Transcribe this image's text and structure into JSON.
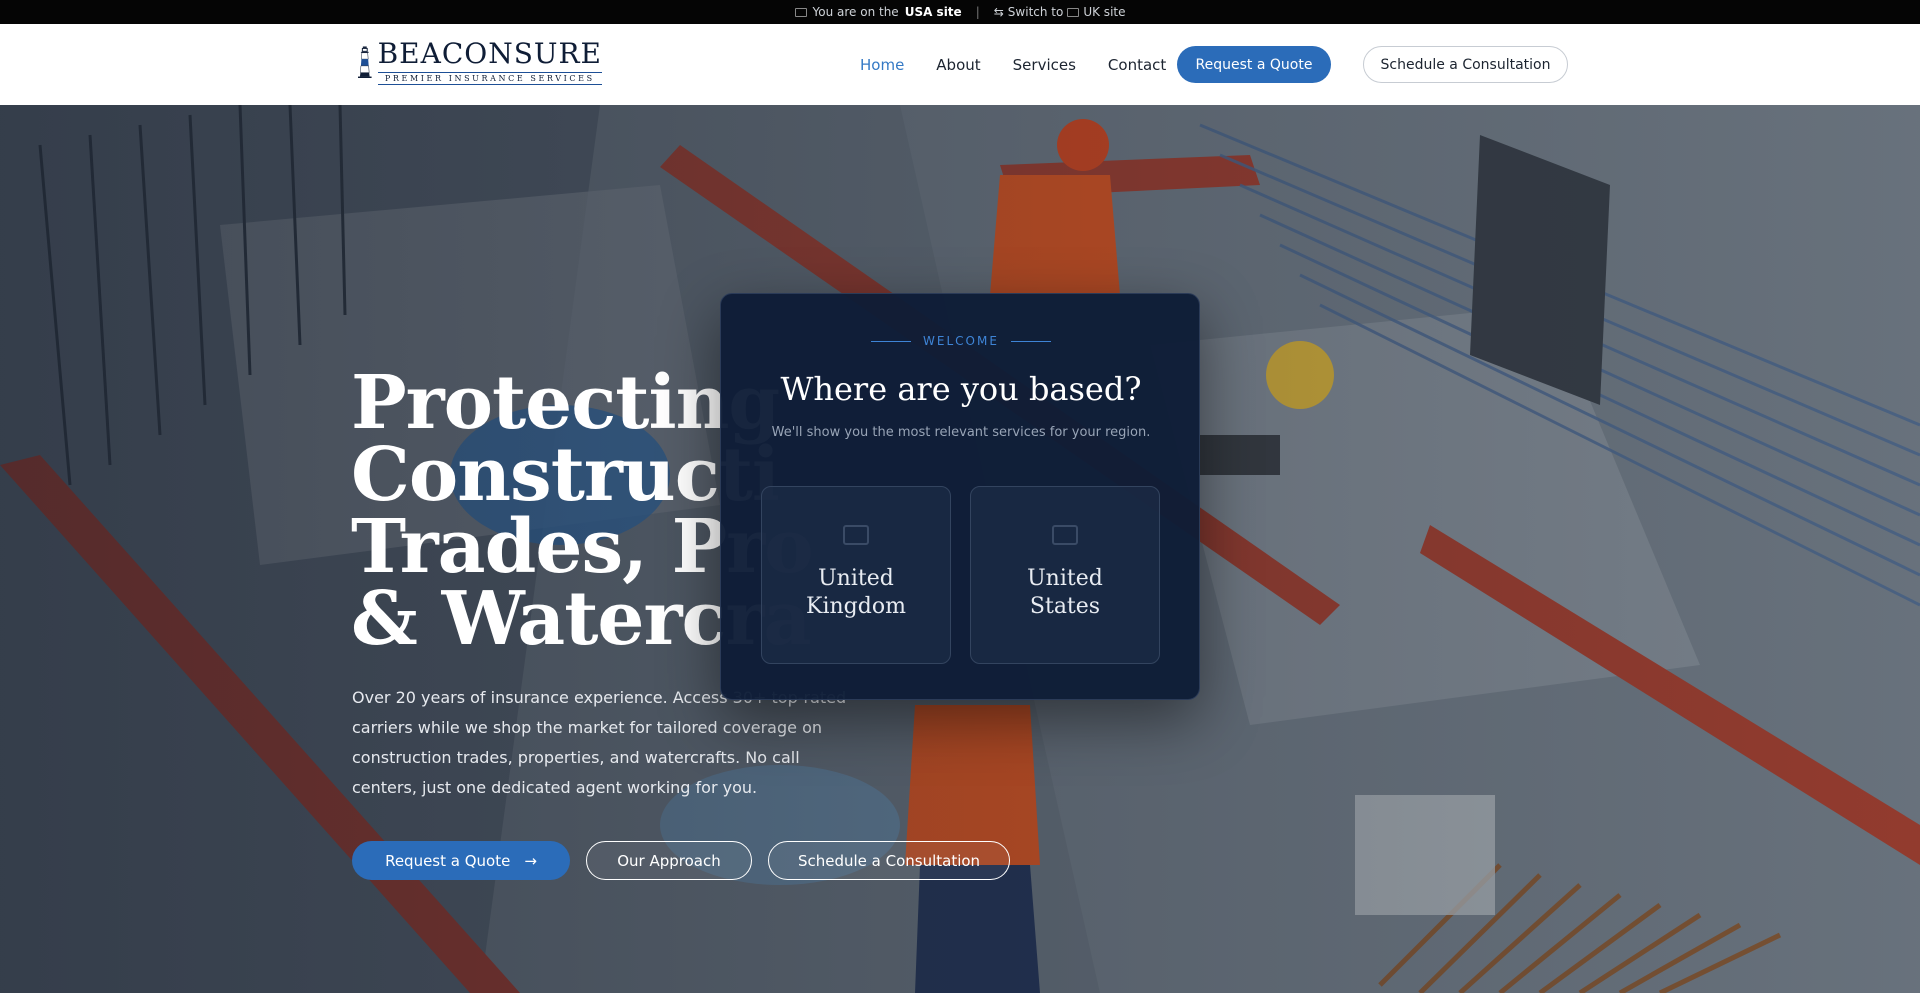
{
  "topbar": {
    "prefix": "You are on the",
    "current_site": "USA site",
    "separator": "|",
    "switch_label": "Switch to",
    "switch_target": "UK site"
  },
  "header": {
    "brand": "BEACONSURE",
    "tagline": "PREMIER INSURANCE SERVICES",
    "nav": [
      {
        "label": "Home",
        "active": true
      },
      {
        "label": "About",
        "active": false
      },
      {
        "label": "Services",
        "active": false
      },
      {
        "label": "Contact",
        "active": false
      }
    ],
    "quote_button": "Request a Quote",
    "consult_button": "Schedule a Consultation"
  },
  "hero": {
    "title_line1": "Protecting",
    "title_line2": "Constructi",
    "title_line3": "Trades, Pro",
    "title_line4": "& Watercra",
    "description": "Over 20 years of insurance experience. Access 30+ top-rated carriers while we shop the market for tailored coverage on construction trades, properties, and watercrafts. No call centers, just one dedicated agent working for you.",
    "btn_quote": "Request a Quote",
    "btn_approach": "Our Approach",
    "btn_consult": "Schedule a Consultation"
  },
  "modal": {
    "eyebrow": "WELCOME",
    "title": "Where are you based?",
    "subtitle": "We'll show you the most relevant services for your region.",
    "options": [
      {
        "label": "United Kingdom"
      },
      {
        "label": "United States"
      }
    ]
  },
  "colors": {
    "accent": "#2b6cb9",
    "nav_active": "#3479c5",
    "modal_bg": "#0e1c36"
  }
}
